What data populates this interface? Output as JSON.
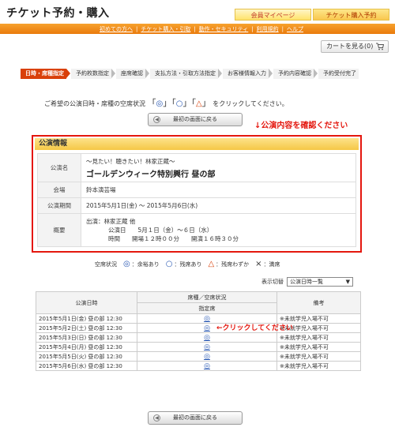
{
  "header": {
    "title": "チケット予約・購入",
    "tabs": [
      "会員マイページ",
      "チケット購入予約"
    ]
  },
  "nav_links": [
    "初めての方へ",
    "チケット購入・引取",
    "動作・セキュリティ",
    "利用規約",
    "ヘルプ"
  ],
  "cart": {
    "label": "カートを見る(0)"
  },
  "steps": [
    "日時・席種指定",
    "予約枚数指定",
    "座席確認",
    "支払方法・引取方法指定",
    "お客様情報入力",
    "予約内容確認",
    "予約受付完了"
  ],
  "instruction": {
    "text_before": "ご希望の公演日時・席種の空席状況",
    "symbols": [
      "◎",
      "○",
      "△"
    ],
    "text_after": "をクリックしてください。"
  },
  "back_button_label": "最初の画面に戻る",
  "annotation_confirm": "↓公演内容を確認ください",
  "info": {
    "title": "公演情報",
    "rows": [
      {
        "key": "公演名",
        "sub": "～見たい！聴きたい！林家正蔵～",
        "main": "ゴールデンウィーク特別興行 昼の部"
      },
      {
        "key": "会場",
        "value": "鈴本演芸場"
      },
      {
        "key": "公演期間",
        "value": "2015年5月1日(金) ～ 2015年5月6日(水)"
      },
      {
        "key": "概要",
        "lines": [
          "出演：林家正蔵 他",
          "公演日　　5月１日（金）～６日（水）",
          "時間　　開場１２時００分　　開演１６時３０分"
        ]
      }
    ]
  },
  "legend": {
    "label": "空席状況",
    "items": [
      {
        "sym": "◎",
        "text": "：余裕あり"
      },
      {
        "sym": "○",
        "text": "：残席あり"
      },
      {
        "sym": "△",
        "text": "：残席わずか"
      },
      {
        "sym": "×",
        "text": "：満席"
      }
    ]
  },
  "display_switch": {
    "label": "表示切替",
    "value": "公演日時一覧"
  },
  "schedule": {
    "headers": {
      "datetime": "公演日時",
      "seat_status": "席種／空席状況",
      "seat_type": "指定席",
      "remarks": "備考"
    },
    "rows": [
      {
        "date": "2015年5月1日(金) 昼の部 12:30",
        "status": "◎",
        "note": "※未就学児入場不可"
      },
      {
        "date": "2015年5月2日(土) 昼の部 12:30",
        "status": "◎",
        "note": "※未就学児入場不可"
      },
      {
        "date": "2015年5月3日(日) 昼の部 12:30",
        "status": "◎",
        "note": "※未就学児入場不可"
      },
      {
        "date": "2015年5月4日(月) 昼の部 12:30",
        "status": "◎",
        "note": "※未就学児入場不可"
      },
      {
        "date": "2015年5月5日(火) 昼の部 12:30",
        "status": "◎",
        "note": "※未就学児入場不可"
      },
      {
        "date": "2015年5月6日(水) 昼の部 12:30",
        "status": "◎",
        "note": "※未就学児入場不可"
      }
    ]
  },
  "annotation_click": "←クリックしてください",
  "colors": {
    "accent_orange": "#ea7a0c",
    "active_step": "#d9400a",
    "annotation_red": "#e4170e",
    "symbol_blue": "#2a59b3"
  }
}
